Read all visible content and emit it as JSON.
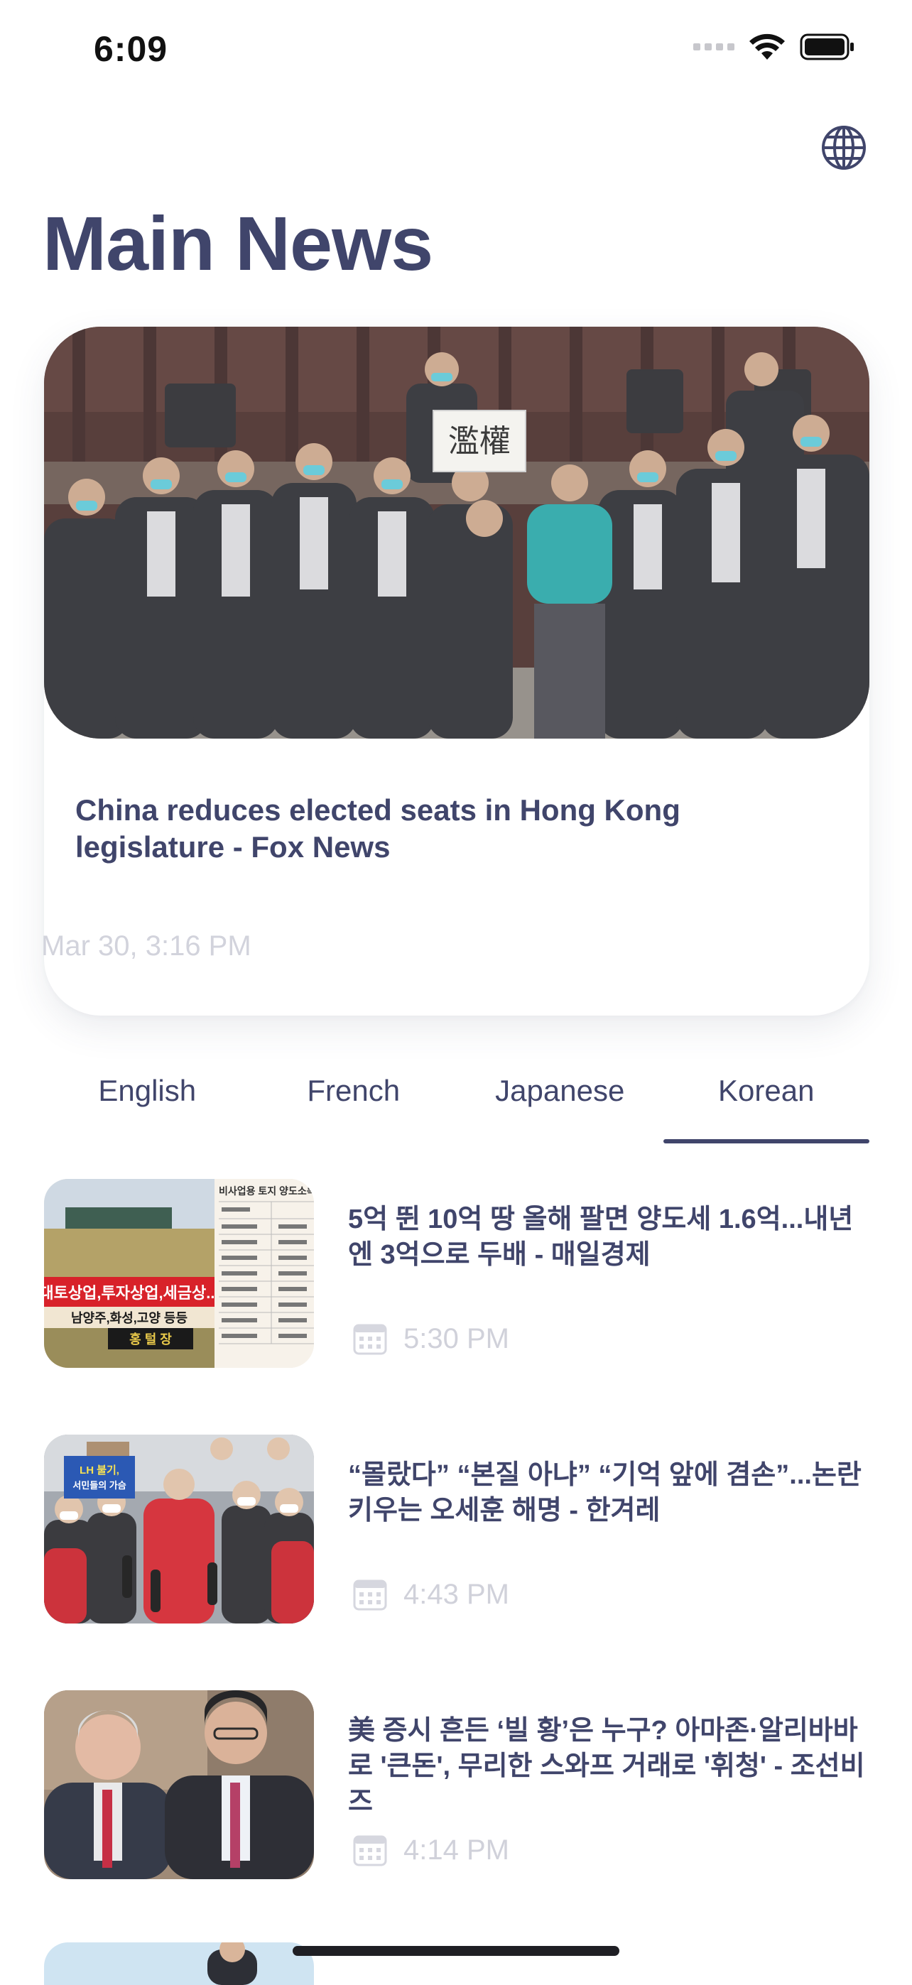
{
  "status_bar": {
    "time": "6:09"
  },
  "header": {
    "title": "Main News",
    "language_icon": "globe-icon"
  },
  "featured": {
    "title": "China reduces elected seats in Hong Kong legislature - Fox News",
    "date": "Mar 30, 3:16 PM",
    "image_sign_text": "濫權"
  },
  "tabs": [
    {
      "label": "English",
      "active": false
    },
    {
      "label": "French",
      "active": false
    },
    {
      "label": "Japanese",
      "active": false
    },
    {
      "label": "Korean",
      "active": true
    }
  ],
  "news": [
    {
      "title": "5억 뛴 10억 땅 올해 팔면 양도세 1.6억...내년엔 3억으로 두배 - 매일경제",
      "time": "5:30 PM",
      "icon": "calendar-icon",
      "thumb": {
        "table_title": "비사업용 토지 양도소득",
        "banner": "대토상업,투자상업,세금상...",
        "banner_sub": "남양주,화성,고양 등등",
        "banner_sign": "홍 털 장"
      }
    },
    {
      "title": "“몰랐다” “본질 아냐” “기억 앞에 겸손”...논란 키우는 오세훈 해명 - 한겨레",
      "time": "4:43 PM",
      "icon": "calendar-icon",
      "thumb": {
        "sign": "LH 불기,",
        "sign_sub": "서민들의 가슴"
      }
    },
    {
      "title": "美 증시 흔든 ‘빌 황’은 누구? 아마존·알리바바로 '큰돈', 무리한 스와프 거래로 '휘청' - 조선비즈",
      "time": "4:14 PM",
      "icon": "calendar-icon"
    }
  ],
  "colors": {
    "primary": "#40456b",
    "muted": "#d0d1da",
    "background": "#ffffff"
  }
}
